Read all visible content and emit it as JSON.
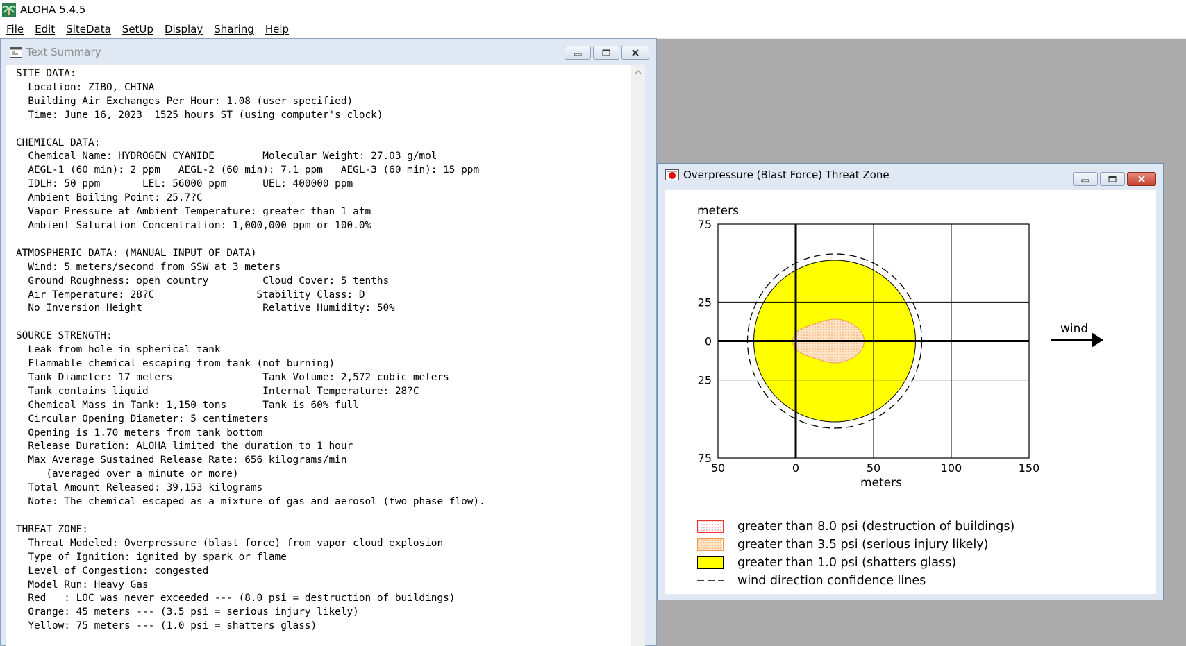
{
  "app": {
    "title": "ALOHA 5.4.5"
  },
  "menu": [
    "File",
    "Edit",
    "SiteData",
    "SetUp",
    "Display",
    "Sharing",
    "Help"
  ],
  "text_window": {
    "title": "Text Summary",
    "lines": [
      "SITE DATA:",
      "  Location: ZIBO, CHINA",
      "  Building Air Exchanges Per Hour: 1.08 (user specified)",
      "  Time: June 16, 2023  1525 hours ST (using computer's clock)",
      "",
      "CHEMICAL DATA:",
      "  Chemical Name: HYDROGEN CYANIDE        Molecular Weight: 27.03 g/mol",
      "  AEGL-1 (60 min): 2 ppm   AEGL-2 (60 min): 7.1 ppm   AEGL-3 (60 min): 15 ppm",
      "  IDLH: 50 ppm       LEL: 56000 ppm      UEL: 400000 ppm",
      "  Ambient Boiling Point: 25.7?C",
      "  Vapor Pressure at Ambient Temperature: greater than 1 atm",
      "  Ambient Saturation Concentration: 1,000,000 ppm or 100.0%",
      "",
      "ATMOSPHERIC DATA: (MANUAL INPUT OF DATA)",
      "  Wind: 5 meters/second from SSW at 3 meters",
      "  Ground Roughness: open country         Cloud Cover: 5 tenths",
      "  Air Temperature: 28?C                 Stability Class: D",
      "  No Inversion Height                    Relative Humidity: 50%",
      "",
      "SOURCE STRENGTH:",
      "  Leak from hole in spherical tank",
      "  Flammable chemical escaping from tank (not burning)",
      "  Tank Diameter: 17 meters               Tank Volume: 2,572 cubic meters",
      "  Tank contains liquid                   Internal Temperature: 28?C",
      "  Chemical Mass in Tank: 1,150 tons      Tank is 60% full",
      "  Circular Opening Diameter: 5 centimeters",
      "  Opening is 1.70 meters from tank bottom",
      "  Release Duration: ALOHA limited the duration to 1 hour",
      "  Max Average Sustained Release Rate: 656 kilograms/min",
      "     (averaged over a minute or more)",
      "  Total Amount Released: 39,153 kilograms",
      "  Note: The chemical escaped as a mixture of gas and aerosol (two phase flow).",
      "",
      "THREAT ZONE:",
      "  Threat Modeled: Overpressure (blast force) from vapor cloud explosion",
      "  Type of Ignition: ignited by spark or flame",
      "  Level of Congestion: congested",
      "  Model Run: Heavy Gas",
      "  Red   : LOC was never exceeded --- (8.0 psi = destruction of buildings)",
      "  Orange: 45 meters --- (3.5 psi = serious injury likely)",
      "  Yellow: 75 meters --- (1.0 psi = shatters glass)"
    ]
  },
  "threat_window": {
    "title": "Overpressure (Blast Force) Threat Zone",
    "wind_label": "wind",
    "legend": [
      {
        "label": "greater than 8.0 psi (destruction of buildings)",
        "color": "#ff6b6b"
      },
      {
        "label": "greater than 3.5 psi (serious injury likely)",
        "color": "#ffa040"
      },
      {
        "label": "greater than 1.0 psi (shatters glass)",
        "color": "#ffff00"
      },
      {
        "label": "wind direction confidence lines",
        "color": "#000000"
      }
    ]
  },
  "chart_data": {
    "type": "area",
    "units": "meters",
    "x_tick_labels": [
      "50",
      "0",
      "50",
      "100",
      "150"
    ],
    "y_tick_labels": [
      "75",
      "25",
      "0",
      "25",
      "75"
    ],
    "xlim": [
      -50,
      150
    ],
    "ylim": [
      -75,
      75
    ],
    "grid": true,
    "zones": [
      {
        "name": "Orange",
        "threshold_psi": 3.5,
        "extent_m": 45
      },
      {
        "name": "Yellow",
        "threshold_psi": 1.0,
        "extent_m": 75,
        "center_x_m": 25,
        "radius_m": 52
      }
    ],
    "colors": {
      "yellow": "#ffff00",
      "orange_fill": "#fde3c4",
      "orange_dot": "#f4a060",
      "red_dot": "#ff6b6b"
    }
  }
}
